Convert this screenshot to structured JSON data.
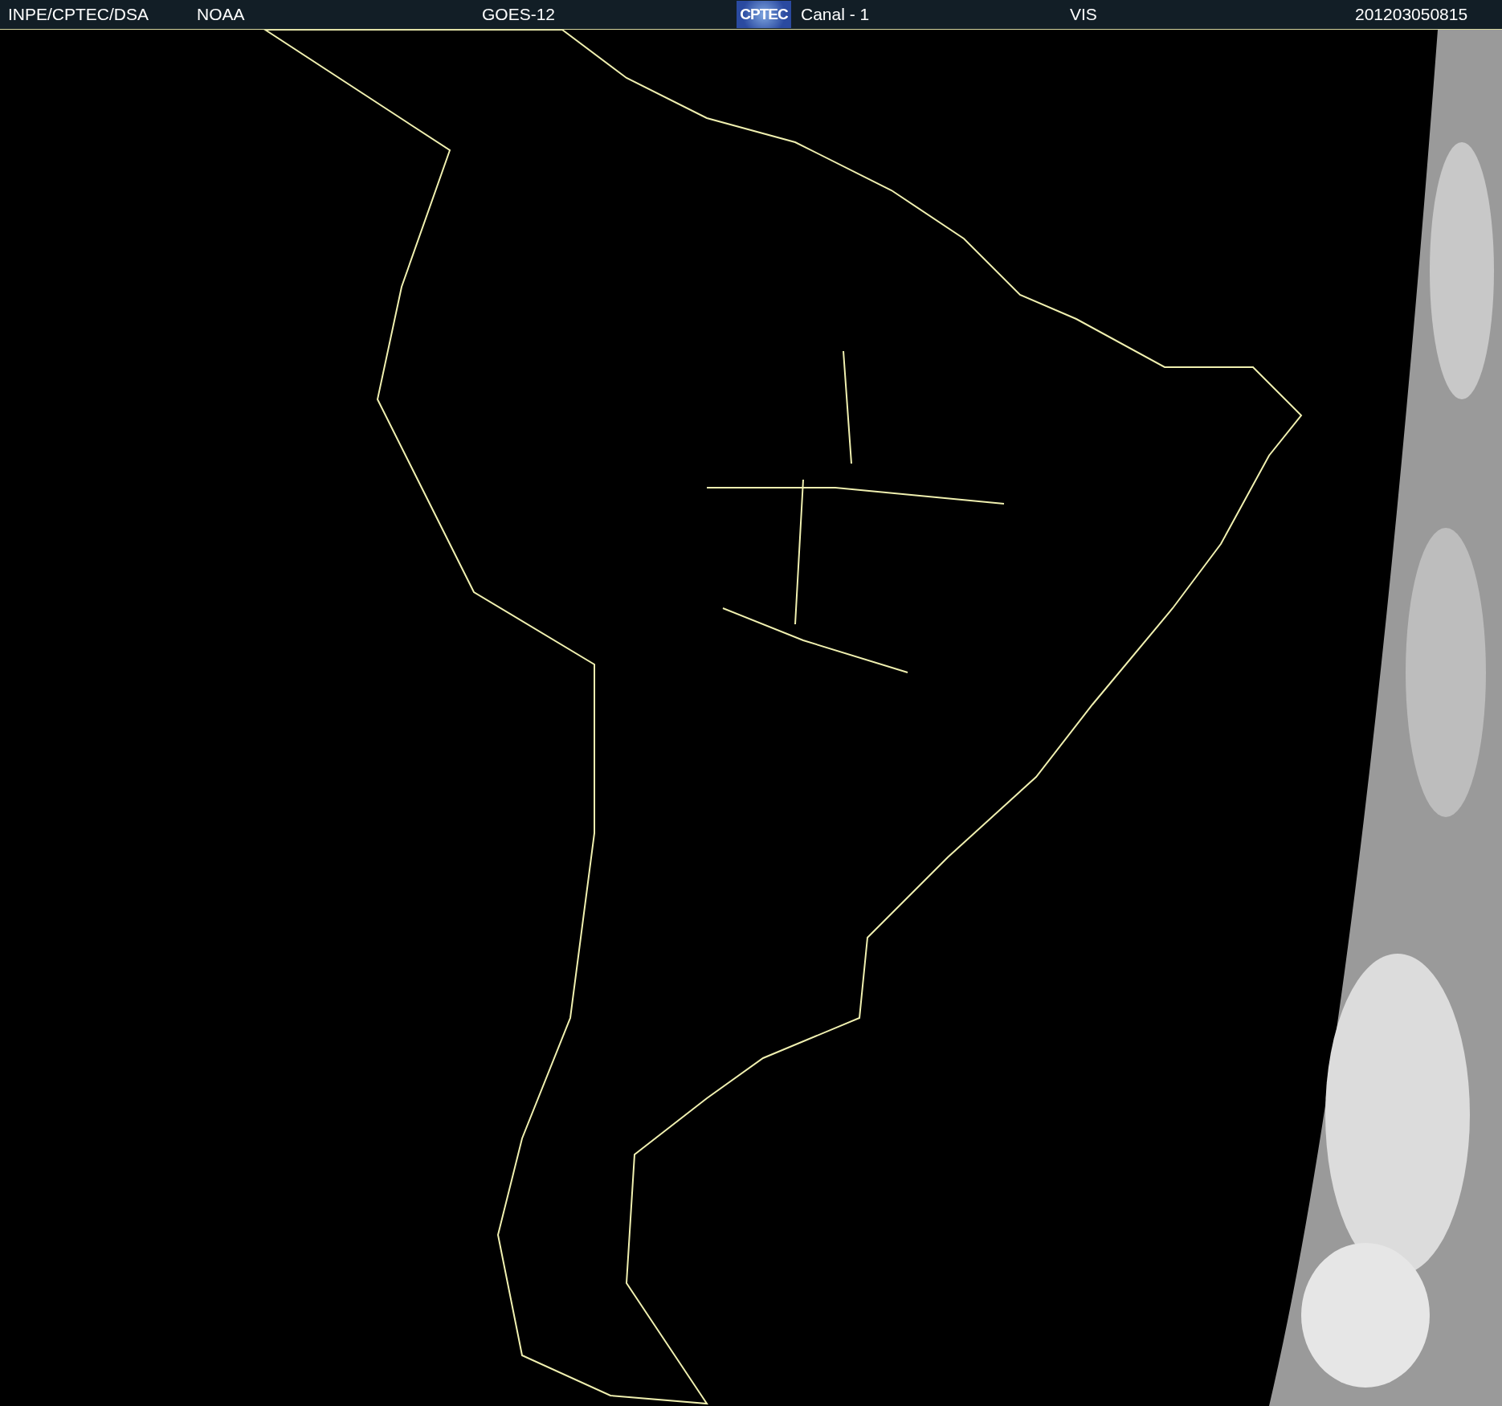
{
  "header": {
    "items": [
      {
        "kind": "text",
        "text": "INPE/CPTEC/DSA"
      },
      {
        "kind": "text",
        "text": "NOAA"
      },
      {
        "kind": "text",
        "text": "GOES-12"
      },
      {
        "kind": "logo",
        "text": "CPTEC"
      },
      {
        "kind": "text",
        "text": "Canal - 1"
      },
      {
        "kind": "text",
        "text": "VIS"
      },
      {
        "kind": "text",
        "text": "201203050815"
      }
    ]
  }
}
